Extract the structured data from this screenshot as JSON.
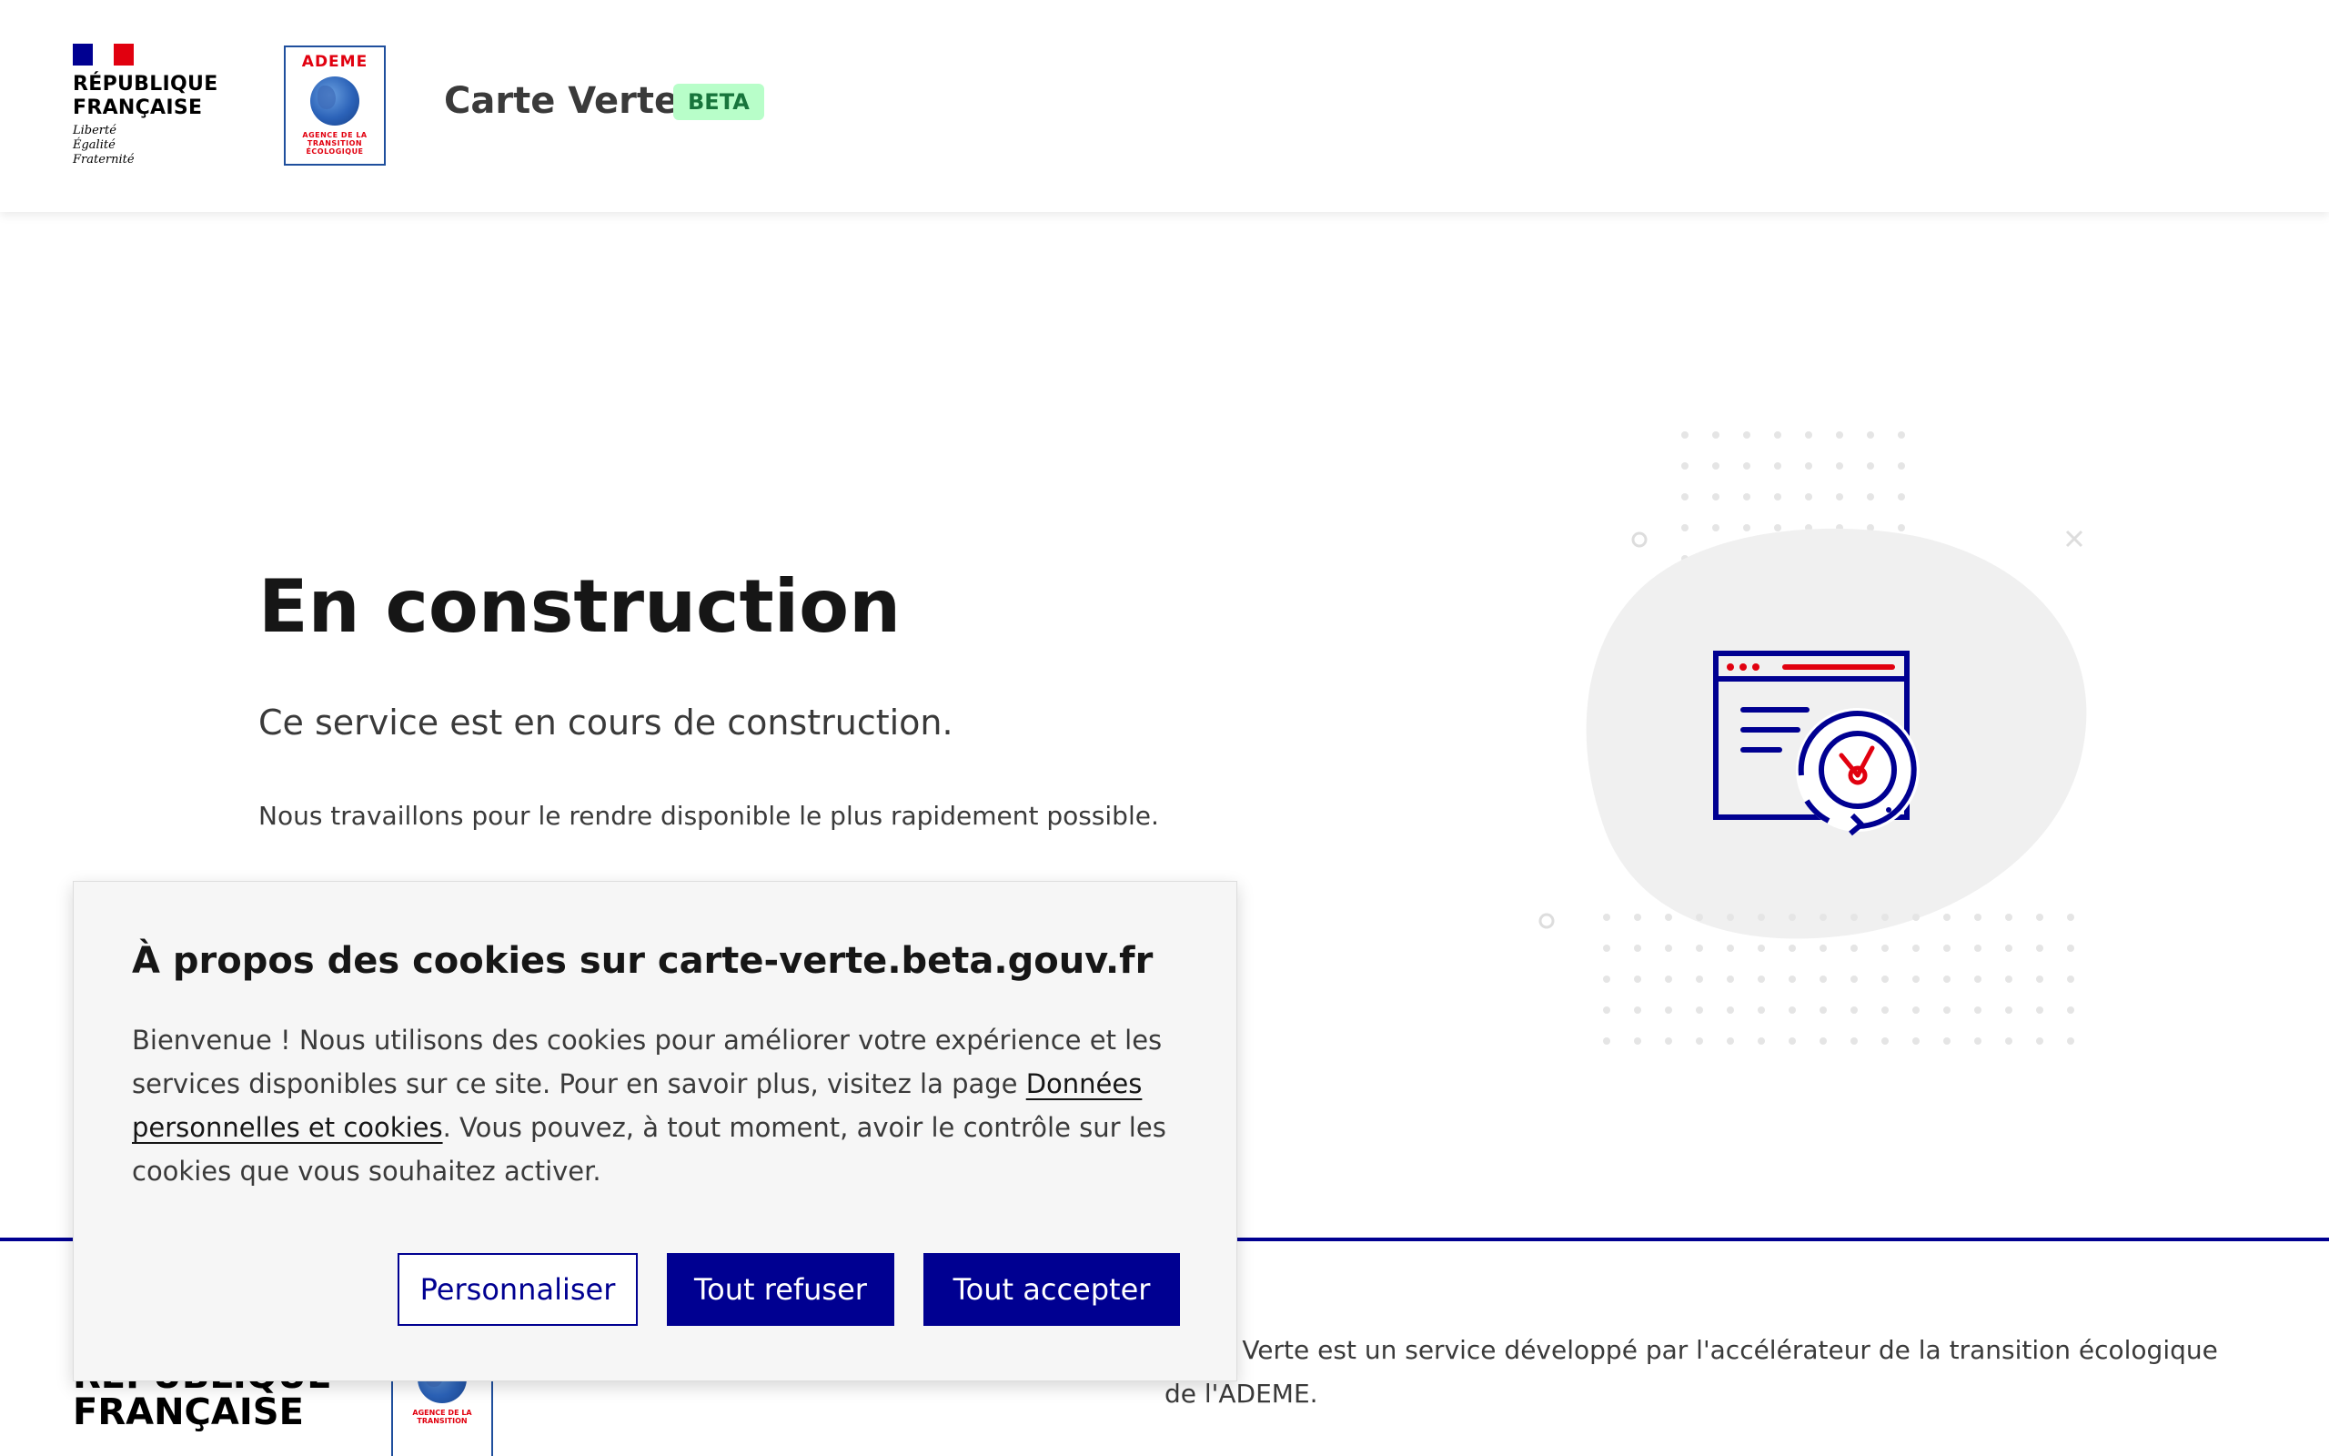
{
  "header": {
    "republique_line1": "RÉPUBLIQUE",
    "republique_line2": "FRANÇAISE",
    "motto_1": "Liberté",
    "motto_2": "Égalité",
    "motto_3": "Fraternité",
    "ademe_label": "ADEME",
    "ademe_sub_1": "AGENCE DE LA",
    "ademe_sub_2": "TRANSITION",
    "ademe_sub_3": "ÉCOLOGIQUE",
    "service_title": "Carte Verte",
    "badge": "BETA"
  },
  "main": {
    "title": "En construction",
    "lead": "Ce service est en cours de construction.",
    "description": "Nous travaillons pour le rendre disponible le plus rapidement possible."
  },
  "cookie_banner": {
    "title": "À propos des cookies sur carte-verte.beta.gouv.fr",
    "body_before_link": "Bienvenue ! Nous utilisons des cookies pour améliorer votre expérience et les services disponibles sur ce site. Pour en savoir plus, visitez la page ",
    "link_text": "Données personnelles et cookies",
    "body_after_link": ".  Vous pouvez, à tout moment, avoir le contrôle sur les cookies que vous souhaitez activer.",
    "customize_label": "Personnaliser",
    "refuse_label": "Tout refuser",
    "accept_label": "Tout accepter"
  },
  "footer": {
    "republique_line1": "RÉPUBLIQUE",
    "republique_line2": "FRANÇAISE",
    "about_text": "Carte Verte est un service développé par l'accélérateur de la transition écologique de l'ADEME."
  },
  "colors": {
    "blue_france": "#000091",
    "red_marianne": "#e1000f",
    "beta_bg": "#b8fec9",
    "beta_text": "#18753c"
  }
}
